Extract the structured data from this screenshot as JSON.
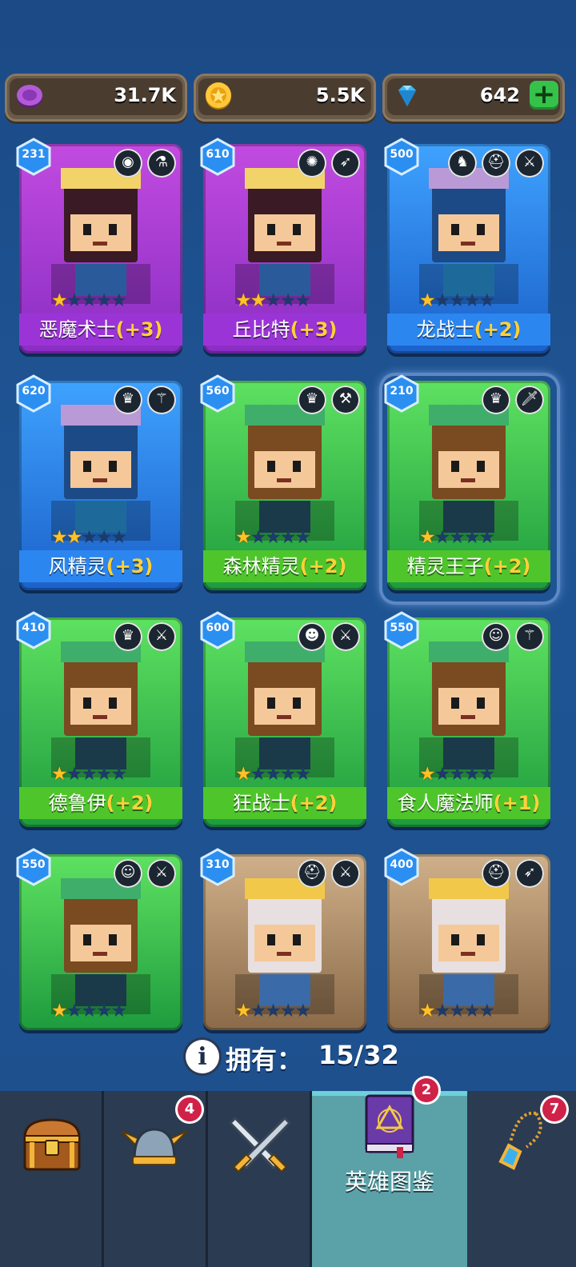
{
  "currency": {
    "elixir": {
      "value": "31.7K",
      "icon": "purple-token-icon"
    },
    "gold": {
      "value": "5.5K",
      "icon": "gold-coin-icon"
    },
    "gems": {
      "value": "642",
      "icon": "blue-gem-icon",
      "add_label": "+"
    }
  },
  "heroes": [
    {
      "name": "恶魔术士",
      "bonus": "(+3)",
      "level": "231",
      "stars": 1,
      "color": "purple",
      "tags": [
        "cyclops-race-icon",
        "magic-flask-icon"
      ]
    },
    {
      "name": "丘比特",
      "bonus": "(+3)",
      "level": "610",
      "stars": 2,
      "color": "purple",
      "tags": [
        "angel-race-icon",
        "bow-icon"
      ]
    },
    {
      "name": "龙战士",
      "bonus": "(+2)",
      "level": "500",
      "stars": 1,
      "color": "blue",
      "tags": [
        "dragon-race-icon",
        "helmet-race-icon",
        "sword-icon"
      ]
    },
    {
      "name": "风精灵",
      "bonus": "(+3)",
      "level": "620",
      "stars": 2,
      "color": "blue",
      "tags": [
        "elf-race-icon",
        "wand-icon"
      ]
    },
    {
      "name": "森林精灵",
      "bonus": "(+2)",
      "level": "560",
      "stars": 1,
      "color": "green",
      "tags": [
        "elf-race-icon",
        "hammer-icon"
      ]
    },
    {
      "name": "精灵王子",
      "bonus": "(+2)",
      "level": "210",
      "stars": 1,
      "color": "green",
      "tags": [
        "elf-race-icon",
        "dagger-icon"
      ]
    },
    {
      "name": "德鲁伊",
      "bonus": "(+2)",
      "level": "410",
      "stars": 1,
      "color": "green",
      "tags": [
        "elf-race-icon",
        "sword-icon"
      ]
    },
    {
      "name": "狂战士",
      "bonus": "(+2)",
      "level": "600",
      "stars": 1,
      "color": "green",
      "tags": [
        "orc-race-icon",
        "sword-icon"
      ]
    },
    {
      "name": "食人魔法师",
      "bonus": "(+1)",
      "level": "550",
      "stars": 1,
      "color": "green",
      "tags": [
        "ogre-race-icon",
        "wand-icon"
      ]
    },
    {
      "name": "",
      "bonus": "",
      "level": "550",
      "stars": 1,
      "color": "green",
      "tags": [
        "ogre-race-icon",
        "sword-icon"
      ]
    },
    {
      "name": "",
      "bonus": "",
      "level": "310",
      "stars": 1,
      "color": "brown",
      "tags": [
        "helmet-race-icon",
        "sword-icon"
      ]
    },
    {
      "name": "",
      "bonus": "",
      "level": "400",
      "stars": 1,
      "color": "brown",
      "tags": [
        "helmet-race-icon",
        "bow-icon"
      ]
    }
  ],
  "owned": {
    "label": "拥有：",
    "value": "15/32",
    "info_icon": "i"
  },
  "nav": {
    "tabs": [
      {
        "id": "chest",
        "icon": "treasure-chest-icon",
        "badge": ""
      },
      {
        "id": "heroes",
        "icon": "winged-helmet-icon",
        "badge": "4"
      },
      {
        "id": "battle",
        "icon": "crossed-swords-icon",
        "badge": ""
      },
      {
        "id": "codex",
        "icon": "spellbook-icon",
        "badge": "2",
        "label": "英雄图鉴"
      },
      {
        "id": "amulet",
        "icon": "amulet-icon",
        "badge": "7"
      }
    ]
  }
}
